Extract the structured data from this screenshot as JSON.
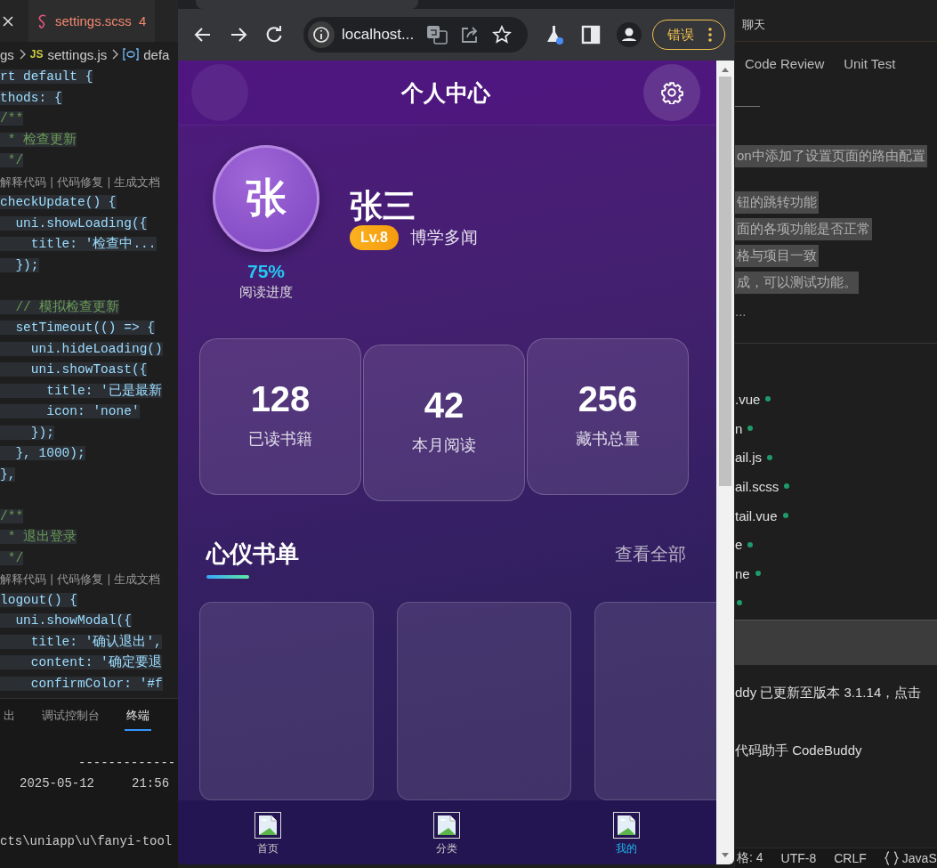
{
  "editor": {
    "tab": {
      "label": "settings.scss",
      "badge": "4"
    },
    "breadcrumbs": {
      "folder": "gs",
      "file_icon": "JS",
      "file": "settings.js",
      "symbol": "defa"
    },
    "lines": [
      {
        "kind": "code",
        "text": "rt default {"
      },
      {
        "kind": "code",
        "text": "thods: {"
      },
      {
        "kind": "comment",
        "text": "/**"
      },
      {
        "kind": "comment",
        "text": " * 检查更新"
      },
      {
        "kind": "comment",
        "text": " */"
      },
      {
        "kind": "lens",
        "text": "解释代码 | 代码修复 | 生成文档"
      },
      {
        "kind": "code",
        "text": "checkUpdate() {"
      },
      {
        "kind": "code",
        "text": "  uni.showLoading({"
      },
      {
        "kind": "code",
        "text": "    title: '检查中..."
      },
      {
        "kind": "code",
        "text": "  });"
      },
      {
        "kind": "blank"
      },
      {
        "kind": "comment",
        "text": "  // 模拟检查更新"
      },
      {
        "kind": "code",
        "text": "  setTimeout(() => {"
      },
      {
        "kind": "code",
        "text": "    uni.hideLoading()"
      },
      {
        "kind": "code",
        "text": "    uni.showToast({"
      },
      {
        "kind": "code",
        "text": "      title: '已是最新"
      },
      {
        "kind": "code",
        "text": "      icon: 'none'"
      },
      {
        "kind": "code",
        "text": "    });"
      },
      {
        "kind": "code",
        "text": "  }, 1000);"
      },
      {
        "kind": "code",
        "text": "},"
      },
      {
        "kind": "blank"
      },
      {
        "kind": "comment",
        "text": "/**"
      },
      {
        "kind": "comment",
        "text": " * 退出登录"
      },
      {
        "kind": "comment",
        "text": " */"
      },
      {
        "kind": "lens",
        "text": "解释代码 | 代码修复 | 生成文档"
      },
      {
        "kind": "code",
        "text": "logout() {"
      },
      {
        "kind": "code",
        "text": "  uni.showModal({"
      },
      {
        "kind": "code",
        "text": "    title: '确认退出',"
      },
      {
        "kind": "code",
        "text": "    content: '确定要退"
      },
      {
        "kind": "code",
        "text": "    confirmColor: '#f"
      }
    ],
    "panel_tabs": [
      {
        "label": "出",
        "selected": false
      },
      {
        "label": "调试控制台",
        "selected": false
      },
      {
        "label": "终端",
        "selected": true
      }
    ],
    "terminal": [
      "-------------",
      "2025-05-12     21:56",
      "cts\\uniapp\\u\\fanyi-tool"
    ]
  },
  "browser": {
    "address": "localhost...",
    "error_button": "错误",
    "page": {
      "title": "个人中心",
      "profile": {
        "avatar": "张",
        "progress": "75%",
        "progress_label": "阅读进度",
        "name": "张三",
        "level": "Lv.8",
        "rank": "博学多闻"
      },
      "stats": [
        {
          "value": "128",
          "label": "已读书籍"
        },
        {
          "value": "42",
          "label": "本月阅读"
        },
        {
          "value": "256",
          "label": "藏书总量"
        }
      ],
      "section": {
        "title": "心仪书单",
        "link": "查看全部"
      },
      "tabbar": [
        {
          "label": "首页",
          "selected": false
        },
        {
          "label": "分类",
          "selected": false
        },
        {
          "label": "我的",
          "selected": true
        }
      ]
    }
  },
  "chat_panel": {
    "title": "聊天",
    "tabs": [
      "Code Review",
      "Unit Test"
    ],
    "messages": [
      "on中添加了设置页面的路由配置",
      "钮的跳转功能",
      "面的各项功能是否正常",
      "格与项目一致",
      "成，可以测试功能。"
    ],
    "ellipsis": "...",
    "files": [
      {
        "name": ".vue",
        "modified": true
      },
      {
        "name": "n",
        "modified": true
      },
      {
        "name": "ail.js",
        "modified": true
      },
      {
        "name": "ail.scss",
        "modified": true
      },
      {
        "name": "tail.vue",
        "modified": true
      },
      {
        "name": "e",
        "modified": true
      },
      {
        "name": "ne",
        "modified": true
      },
      {
        "modified": true
      }
    ],
    "notifications": [
      "ddy 已更新至版本 3.1.14，点击",
      "代码助手 CodeBuddy"
    ]
  },
  "status_bar": {
    "items": [
      "格: 4",
      "UTF-8",
      "CRLF",
      "JavaS"
    ]
  }
}
